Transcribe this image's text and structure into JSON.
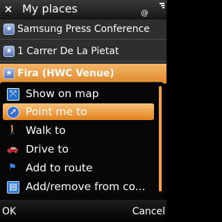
{
  "titlebar": {
    "title": "My places",
    "close_glyph": "×",
    "status_glyph": "@"
  },
  "places": [
    {
      "label": "Samsung Press Conference",
      "icon": "star-badge-icon"
    },
    {
      "label": "1 Carrer De La Pietat",
      "icon": "star-badge-icon"
    },
    {
      "label": "Fira (HWC Venue)",
      "icon": "star-badge-icon",
      "selected": true
    }
  ],
  "menu": {
    "items": [
      {
        "label": "Show on map",
        "icon": "map-icon"
      },
      {
        "label": "Point me to",
        "icon": "compass-icon",
        "highlighted": true
      },
      {
        "label": "Walk to",
        "icon": "walking-person-icon"
      },
      {
        "label": "Drive to",
        "icon": "car-icon"
      },
      {
        "label": "Add to route",
        "icon": "flag-icon"
      },
      {
        "label": "Add/remove from co...",
        "icon": "collection-icon"
      }
    ]
  },
  "softkeys": {
    "left": "OK",
    "right": "Cancel"
  },
  "colors": {
    "highlight": "#e2821e",
    "list_bg": "#2e2e2e",
    "menu_bg": "#050505"
  }
}
